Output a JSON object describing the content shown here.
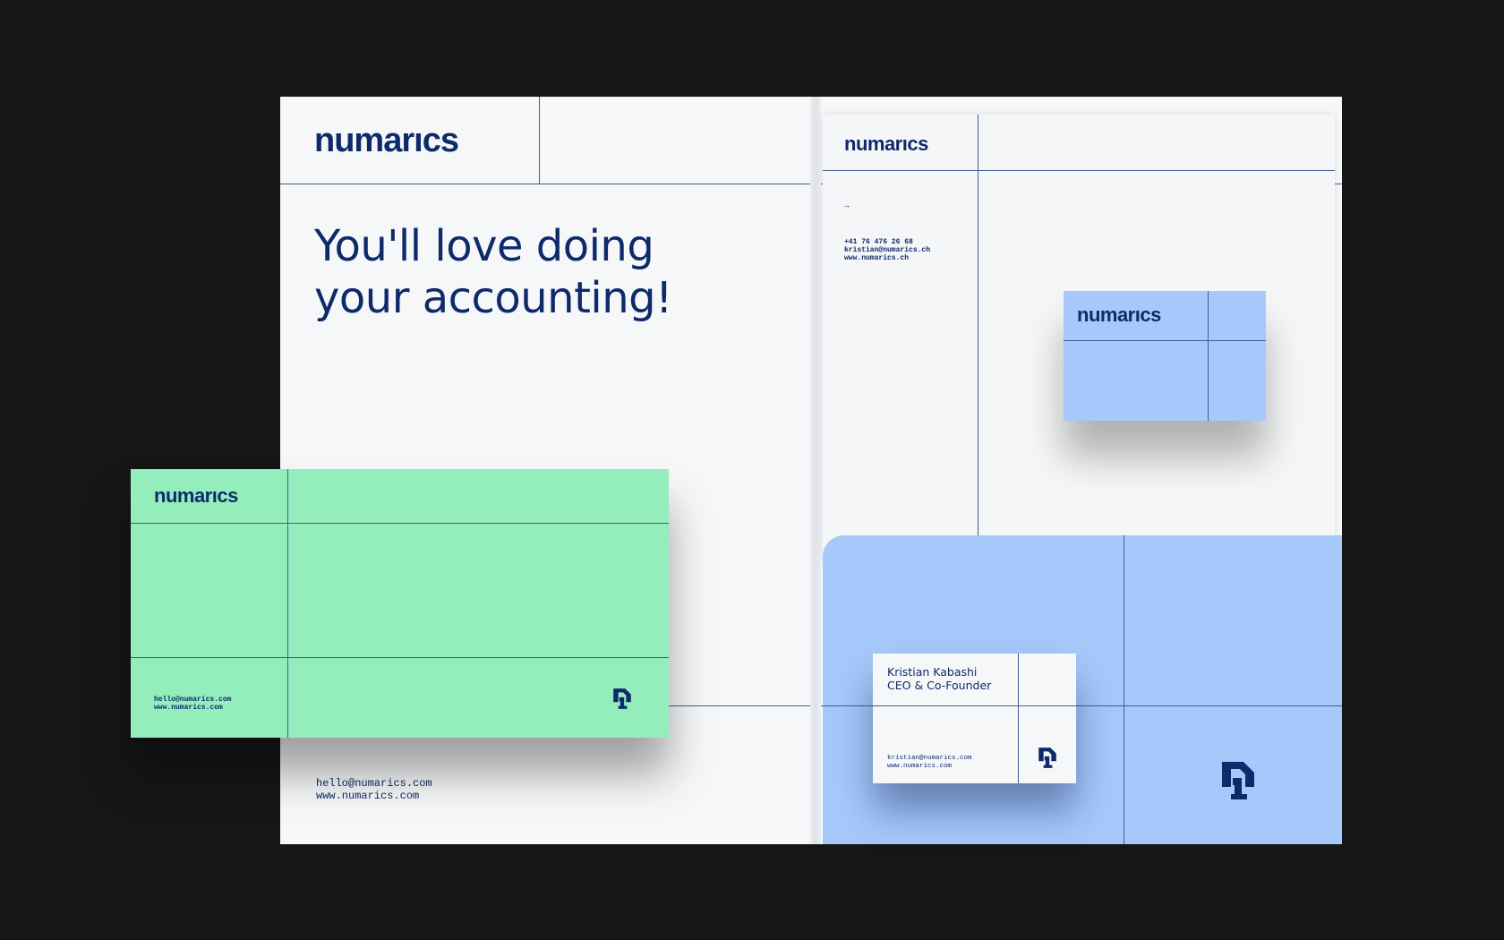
{
  "brand": {
    "logo_text": "numarıcs",
    "colors": {
      "navy": "#0e2a6b",
      "green": "#94eebc",
      "light_blue": "#a6c9fb",
      "paper": "#f6f7f8",
      "background": "#161616"
    }
  },
  "folder": {
    "headline_line1": "You'll love doing",
    "headline_line2": "your accounting!",
    "email": "hello@numarics.com",
    "website": "www.numarics.com"
  },
  "letterhead": {
    "arrow": "→",
    "phone": "+41 76 476 26 68",
    "email": "kristian@numarics.ch",
    "website": "www.numarics.ch"
  },
  "green_card": {
    "email": "hello@numarics.com",
    "website": "www.numarics.com"
  },
  "business_card": {
    "name": "Kristian Kabashi",
    "title": "CEO & Co-Founder",
    "email": "kristian@numarics.com",
    "website": "www.numarics.com"
  }
}
